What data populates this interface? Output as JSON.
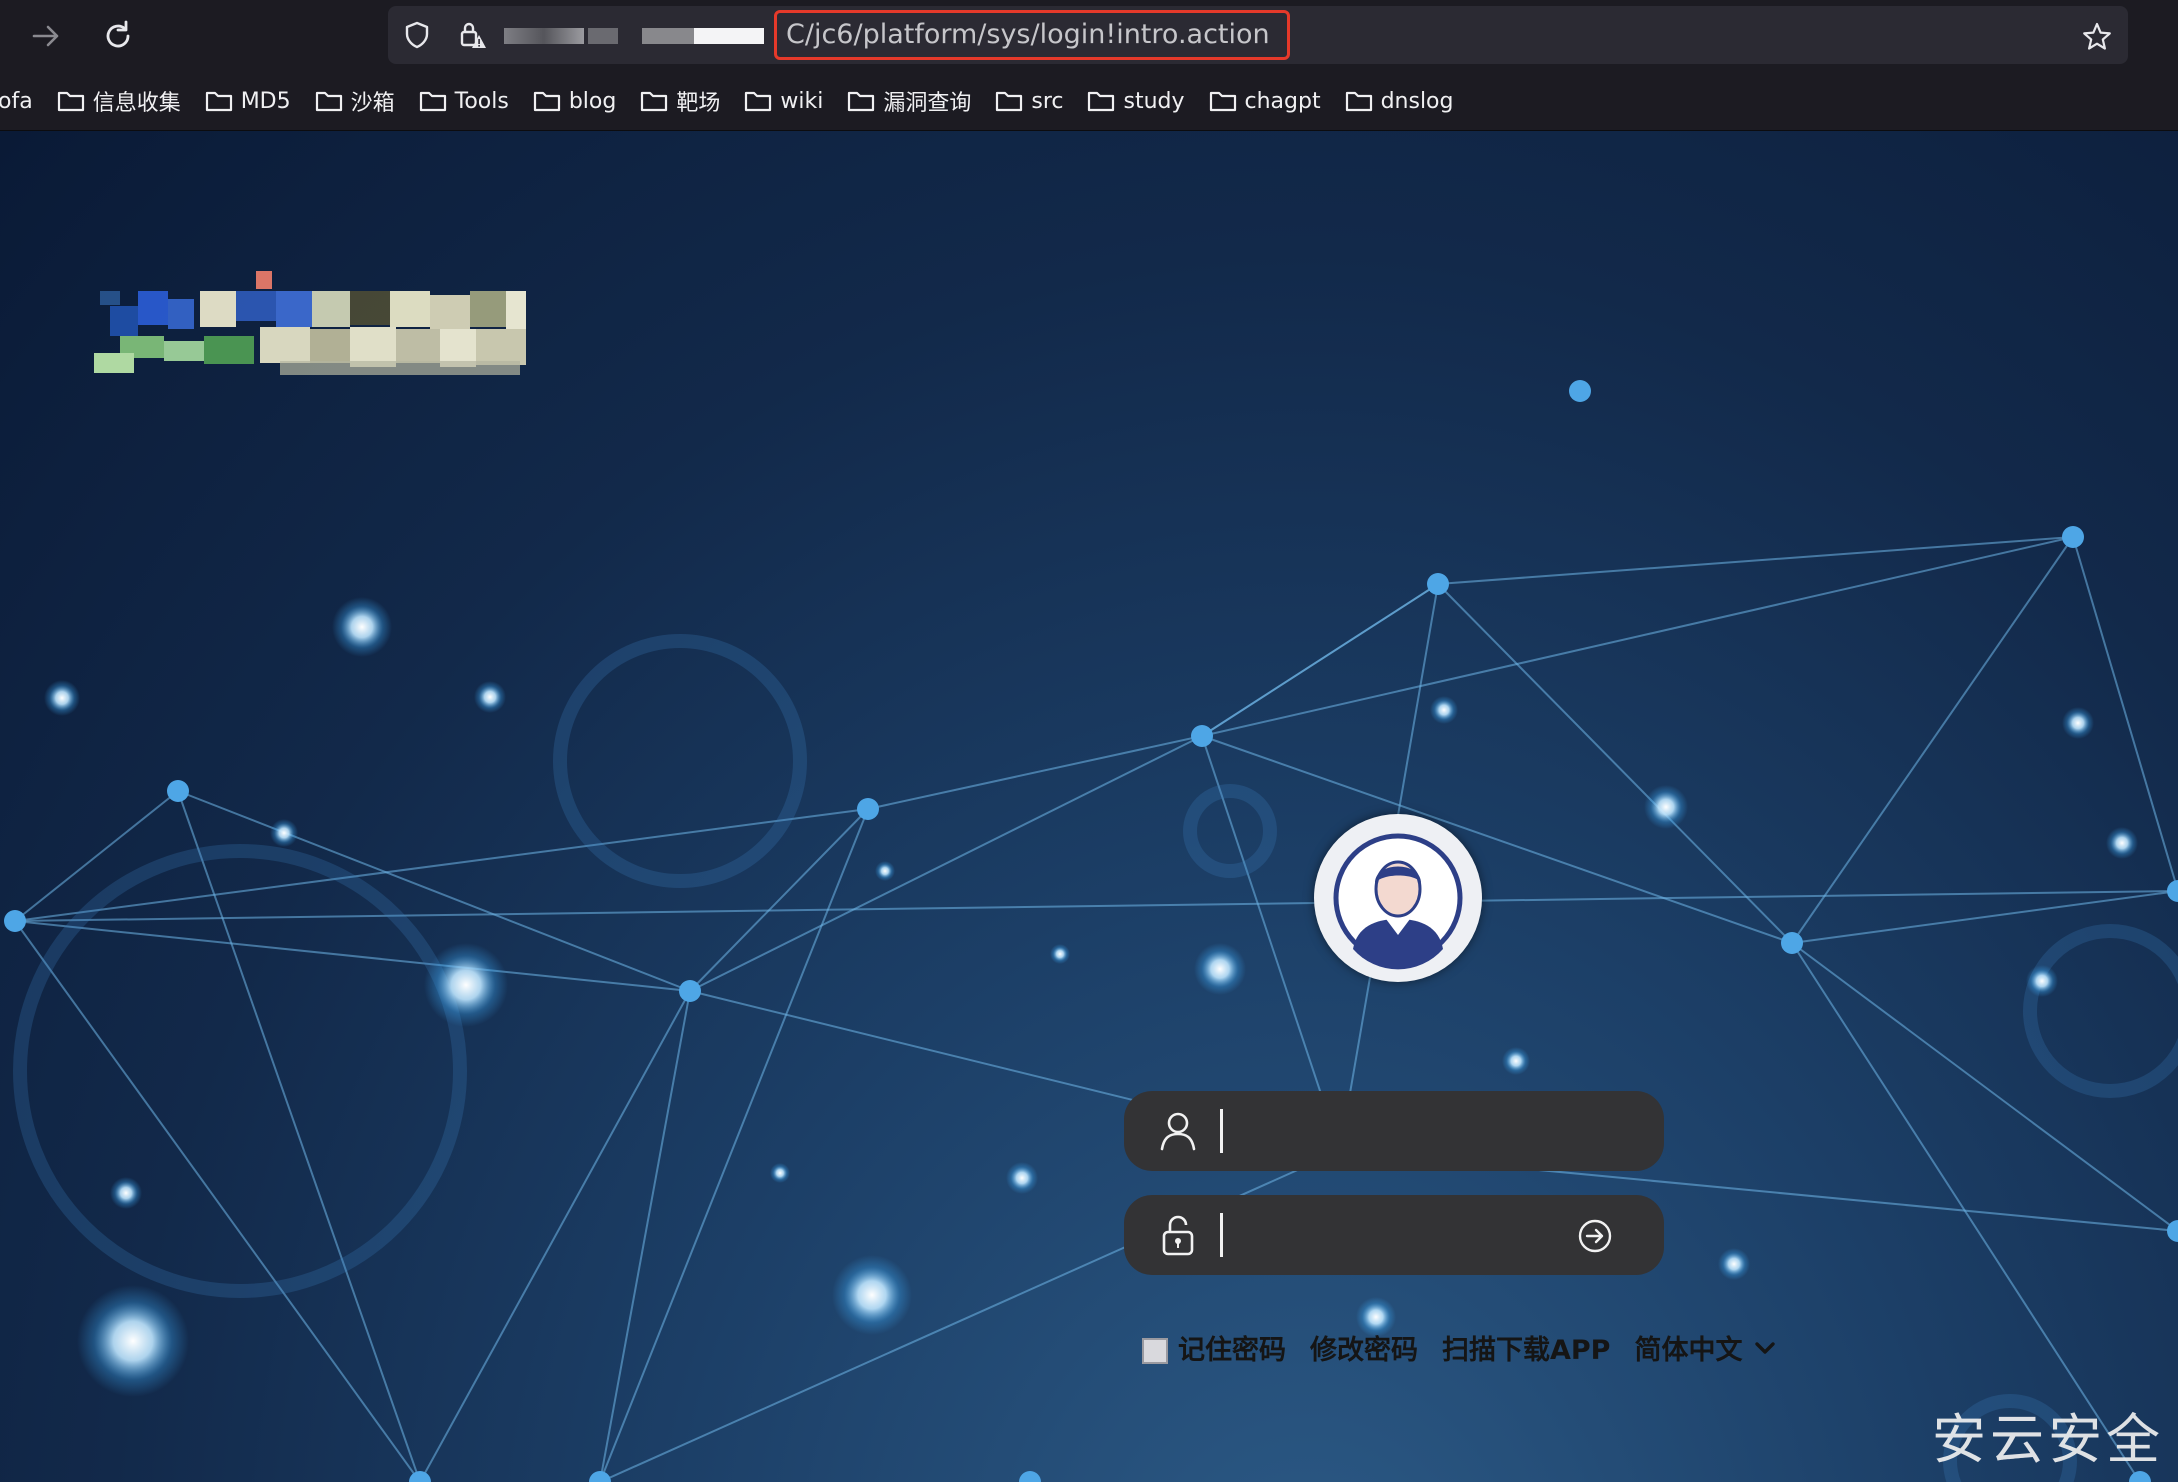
{
  "browser": {
    "url": "C/jc6/platform/sys/login!intro.action",
    "nav_forward_icon": "arrow-right-icon",
    "reload_icon": "reload-icon",
    "security_icon": "shield-icon",
    "lock_icon": "lock-warning-icon",
    "bookmark_star_icon": "star-icon",
    "highlight_color": "#e5392a"
  },
  "bookmarks": [
    {
      "label": "ofa"
    },
    {
      "label": "信息收集"
    },
    {
      "label": "MD5"
    },
    {
      "label": "沙箱"
    },
    {
      "label": "Tools"
    },
    {
      "label": "blog"
    },
    {
      "label": "靶场"
    },
    {
      "label": "wiki"
    },
    {
      "label": "漏洞查询"
    },
    {
      "label": "src"
    },
    {
      "label": "study"
    },
    {
      "label": "chagpt"
    },
    {
      "label": "dnslog"
    }
  ],
  "login": {
    "username_value": "",
    "password_value": "",
    "remember_label": "记住密码",
    "change_password_label": "修改密码",
    "download_app_label": "扫描下载APP",
    "language_label": "简体中文",
    "remember_checked": false
  },
  "watermark": "安云安全"
}
